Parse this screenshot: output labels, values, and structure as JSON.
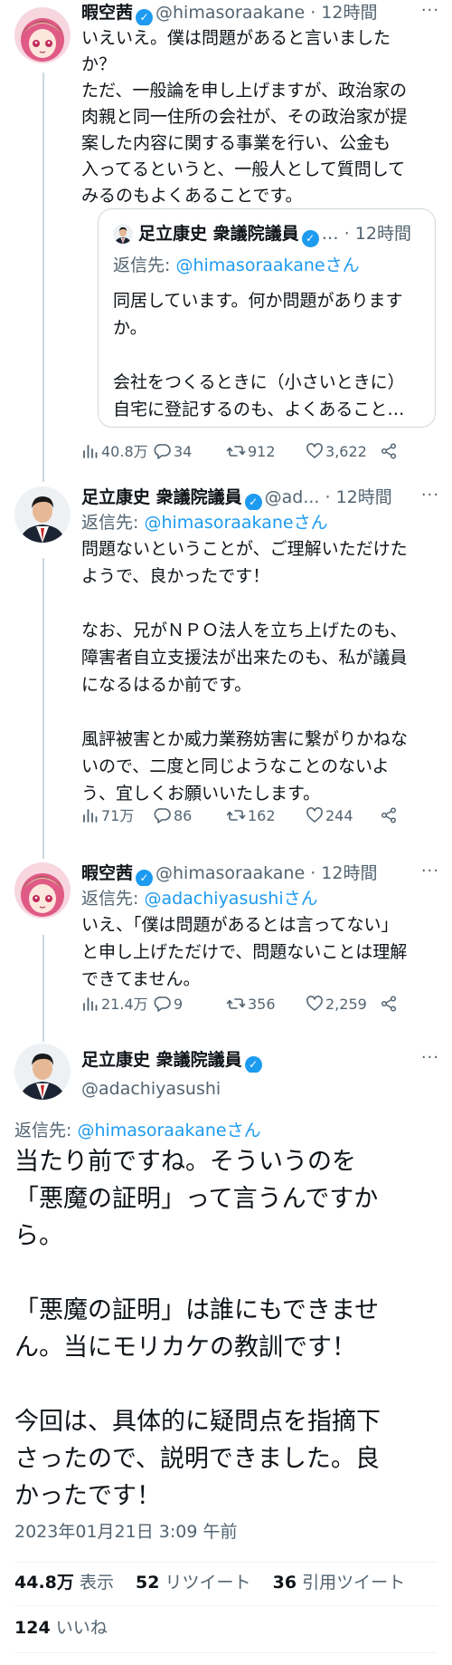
{
  "t1": {
    "name": "暇空茜",
    "handle": "@himasoraakane",
    "dot": "·",
    "time": "12時間",
    "text": "いえいえ。僕は問題があると言いました\nか？\nただ、一般論を申し上げますが、政治家の\n肉親と同一住所の会社が、その政治家が提\n案した内容に関する事業を行い、公金も\n入ってるというと、一般人として質問して\nみるのもよくあることです。",
    "quote": {
      "name": "足立康史 衆議院議員",
      "ellipsis": "…",
      "dot": "·",
      "time": "12時間",
      "reply_prefix": "返信先: ",
      "reply_handle": "@himasoraakaneさん",
      "text": "同居しています。何か問題があります\nか。\n\n会社をつくるときに（小さいときに）\n自宅に登記するのも、よくあること…"
    },
    "views": "40.8万",
    "replies": "34",
    "retweets": "912",
    "likes": "3,622"
  },
  "t2": {
    "name": "足立康史 衆議院議員",
    "handle": "@ad...",
    "dot": "·",
    "time": "12時間",
    "reply_prefix": "返信先: ",
    "reply_handle": "@himasoraakaneさん",
    "text": "問題ないということが、ご理解いただけた\nようで、良かったです！\n\nなお、兄がＮＰＯ法人を立ち上げたのも、\n障害者自立支援法が出来たのも、私が議員\nになるはるか前です。\n\n風評被害とか威力業務妨害に繋がりかねな\nいので、二度と同じようなことのないよ\nう、宜しくお願いいたします。",
    "views": "71万",
    "replies": "86",
    "retweets": "162",
    "likes": "244"
  },
  "t3": {
    "name": "暇空茜",
    "handle": "@himasoraakane",
    "dot": "·",
    "time": "12時間",
    "reply_prefix": "返信先: ",
    "reply_handle": "@adachiyasushiさん",
    "text": "いえ、「僕は問題があるとは言ってない」\nと申し上げただけで、問題ないことは理解\nできてません。",
    "views": "21.4万",
    "replies": "9",
    "retweets": "356",
    "likes": "2,259"
  },
  "t4": {
    "name": "足立康史 衆議院議員",
    "handle": "@adachiyasushi",
    "reply_prefix": "返信先: ",
    "reply_handle": "@himasoraakaneさん",
    "text": "当たり前ですね。そういうのを\n「悪魔の証明」って言うんですか\nら。\n\n「悪魔の証明」は誰にもできませ\nん。当にモリカケの教訓です！\n\n今回は、具体的に疑問点を指摘下\nさったので、説明できました。良\nかったです！",
    "timestamp": "2023年01月21日 3:09 午前",
    "stats": {
      "views_num": "44.8万",
      "views_label": "表示",
      "retweets_num": "52",
      "retweets_label": "リツイート",
      "quotes_num": "36",
      "quotes_label": "引用ツイート",
      "likes_num": "124",
      "likes_label": "いいね"
    }
  },
  "icons": {
    "more": "more-dots-icon",
    "verified": "verified-badge-icon",
    "views": "views-chart-icon",
    "reply": "reply-bubble-icon",
    "retweet": "retweet-icon",
    "like": "heart-icon",
    "share": "share-icon"
  },
  "colors": {
    "accent": "#1d9bf0",
    "secondary_text": "#536471",
    "border": "#cfd9de"
  }
}
